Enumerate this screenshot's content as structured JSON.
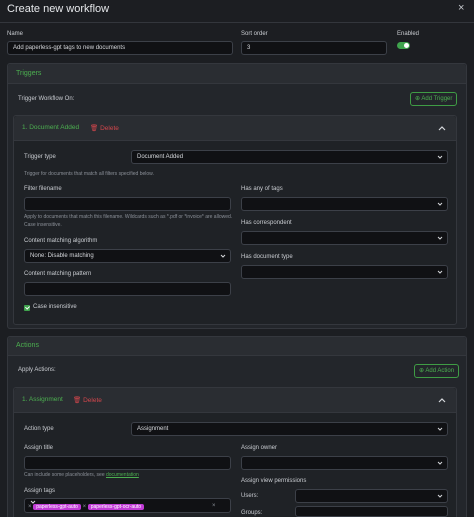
{
  "modal": {
    "title": "Create new workflow",
    "close_icon": "close-icon"
  },
  "general": {
    "name_label": "Name",
    "name_value": "Add paperless-gpt tags to new documents",
    "sort_label": "Sort order",
    "sort_value": "3",
    "enabled_label": "Enabled",
    "enabled": true
  },
  "triggers": {
    "section_title": "Triggers",
    "trigger_on_label": "Trigger Workflow On:",
    "add_label": "Add Trigger",
    "item": {
      "title": "1. Document Added",
      "delete_label": "Delete",
      "type_label": "Trigger type",
      "type_value": "Document Added",
      "type_hint": "Trigger for documents that match all filters specified below.",
      "filter_filename_label": "Filter filename",
      "filter_filename_value": "",
      "filter_filename_hint": "Apply to documents that match this filename. Wildcards such as *.pdf or *invoice* are allowed. Case insensitive.",
      "matching_algo_label": "Content matching algorithm",
      "matching_algo_value": "None: Disable matching",
      "matching_pattern_label": "Content matching pattern",
      "matching_pattern_value": "",
      "case_insensitive_label": "Case insensitive",
      "case_insensitive": true,
      "has_tags_label": "Has any of tags",
      "has_correspondent_label": "Has correspondent",
      "has_doctype_label": "Has document type"
    }
  },
  "actions": {
    "section_title": "Actions",
    "apply_label": "Apply Actions:",
    "add_label": "Add Action",
    "item": {
      "title": "1. Assignment",
      "delete_label": "Delete",
      "type_label": "Action type",
      "type_value": "Assignment",
      "assign_title_label": "Assign title",
      "assign_title_value": "",
      "assign_title_hint": "Can include some placeholders, see",
      "assign_title_link": "documentation",
      "assign_tags_label": "Assign tags",
      "tags": [
        "paperless-gpt-auto",
        "paperless-gpt-ocr-auto"
      ],
      "assign_owner_label": "Assign owner",
      "view_permissions_label": "Assign view permissions",
      "users_label": "Users:",
      "groups_label": "Groups:"
    }
  },
  "colors": {
    "accent": "#4caf50",
    "danger": "#d2464c",
    "tag": "#c13bd6"
  }
}
